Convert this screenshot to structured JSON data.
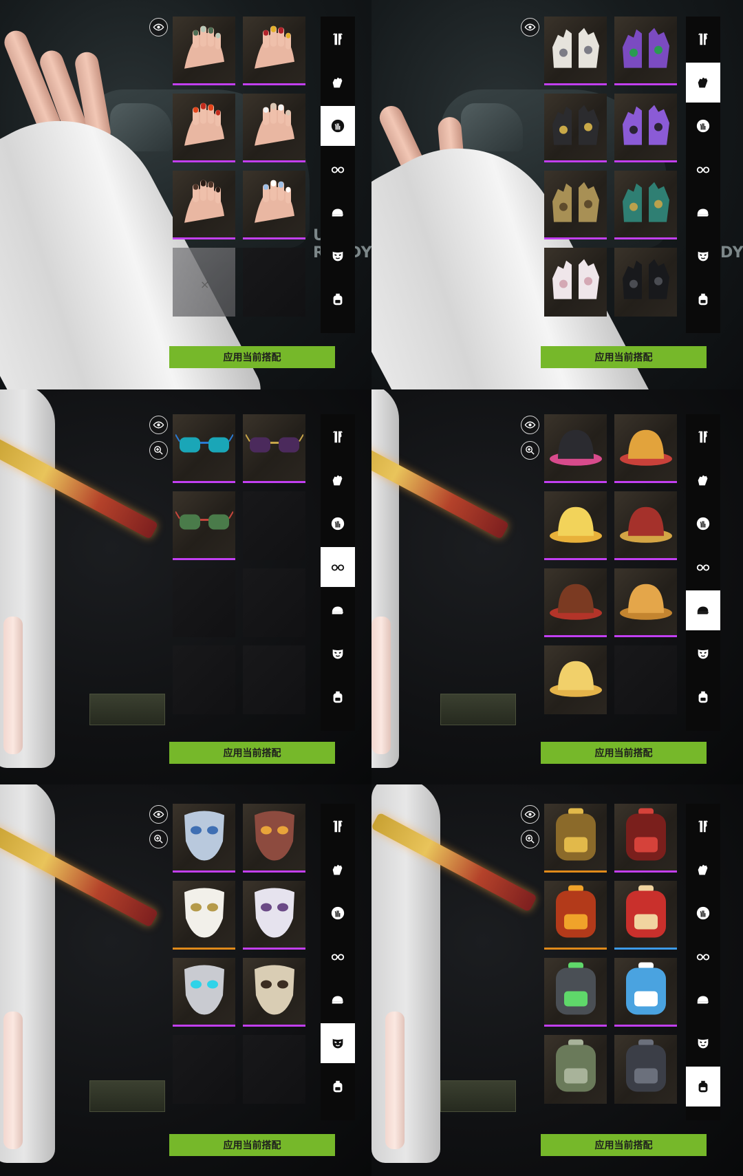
{
  "apply_label": "应用当前搭配",
  "background_text": "US READY",
  "rarity_colors": {
    "purple": "#c23ff2",
    "orange": "#e08a1a",
    "blue": "#3d9be8",
    "none": "#000000"
  },
  "accent_color": "#76b82a",
  "categories": [
    {
      "key": "outfit",
      "icon": "outfit-icon"
    },
    {
      "key": "gloves",
      "icon": "glove-icon"
    },
    {
      "key": "nails",
      "icon": "hand-nail-icon"
    },
    {
      "key": "eyewear",
      "icon": "glasses-icon"
    },
    {
      "key": "hat",
      "icon": "cap-icon"
    },
    {
      "key": "mask",
      "icon": "mask-icon"
    },
    {
      "key": "backpack",
      "icon": "backpack-icon"
    }
  ],
  "panels": [
    {
      "active_category": "nails",
      "side_buttons": [
        "eye-icon"
      ],
      "tiles": [
        {
          "item": "nail-set-green",
          "rarity": "purple"
        },
        {
          "item": "nail-set-red-gold",
          "rarity": "purple"
        },
        {
          "item": "nail-set-orange",
          "rarity": "purple"
        },
        {
          "item": "nail-set-white-gem",
          "rarity": "purple"
        },
        {
          "item": "nail-set-brown-pattern",
          "rarity": "purple"
        },
        {
          "item": "nail-set-blue-white",
          "rarity": "purple"
        },
        {
          "item": "remove-nails",
          "rarity": "none"
        },
        {
          "item": "empty",
          "rarity": "none"
        }
      ]
    },
    {
      "active_category": "gloves",
      "side_buttons": [
        "eye-icon"
      ],
      "tiles": [
        {
          "item": "glove-white-splash",
          "rarity": "purple"
        },
        {
          "item": "glove-purple-web",
          "rarity": "purple"
        },
        {
          "item": "glove-black-gold",
          "rarity": "purple"
        },
        {
          "item": "glove-purple-black",
          "rarity": "purple"
        },
        {
          "item": "glove-gold-armor",
          "rarity": "purple"
        },
        {
          "item": "glove-teal-wire",
          "rarity": "purple"
        },
        {
          "item": "glove-bunny",
          "rarity": "none"
        },
        {
          "item": "glove-black-leather",
          "rarity": "none"
        }
      ]
    },
    {
      "active_category": "eyewear",
      "side_buttons": [
        "eye-icon",
        "zoom-icon"
      ],
      "tiles": [
        {
          "item": "pixel-sunglasses",
          "rarity": "purple"
        },
        {
          "item": "round-purple-glasses",
          "rarity": "purple"
        },
        {
          "item": "star-glasses",
          "rarity": "purple"
        },
        {
          "item": "empty",
          "rarity": "none"
        },
        {
          "item": "empty",
          "rarity": "none"
        },
        {
          "item": "empty",
          "rarity": "none"
        },
        {
          "item": "empty",
          "rarity": "none"
        },
        {
          "item": "empty",
          "rarity": "none"
        }
      ]
    },
    {
      "active_category": "hat",
      "side_buttons": [
        "eye-icon",
        "zoom-icon"
      ],
      "tiles": [
        {
          "item": "cat-ear-headphones",
          "rarity": "purple"
        },
        {
          "item": "straw-hat",
          "rarity": "purple"
        },
        {
          "item": "chick-hat",
          "rarity": "purple"
        },
        {
          "item": "dragon-helm",
          "rarity": "purple"
        },
        {
          "item": "reindeer-hat",
          "rarity": "purple"
        },
        {
          "item": "bear-beanie",
          "rarity": "purple"
        },
        {
          "item": "duck-hat",
          "rarity": "none"
        },
        {
          "item": "empty",
          "rarity": "none"
        }
      ]
    },
    {
      "active_category": "mask",
      "side_buttons": [
        "eye-icon",
        "zoom-icon"
      ],
      "tiles": [
        {
          "item": "crystal-tiara-mask",
          "rarity": "purple"
        },
        {
          "item": "demon-horn-mask",
          "rarity": "purple"
        },
        {
          "item": "bunny-goggle-mask",
          "rarity": "orange"
        },
        {
          "item": "unicorn-mask",
          "rarity": "purple"
        },
        {
          "item": "cyan-visor-mask",
          "rarity": "purple"
        },
        {
          "item": "skull-feather-mask",
          "rarity": "purple"
        },
        {
          "item": "empty",
          "rarity": "none"
        },
        {
          "item": "empty",
          "rarity": "none"
        }
      ]
    },
    {
      "active_category": "backpack",
      "side_buttons": [
        "eye-icon",
        "zoom-icon"
      ],
      "tiles": [
        {
          "item": "golden-bow-pack",
          "rarity": "orange"
        },
        {
          "item": "red-round-pack",
          "rarity": "purple"
        },
        {
          "item": "fire-ring-pack",
          "rarity": "orange"
        },
        {
          "item": "lion-dance-pack",
          "rarity": "blue"
        },
        {
          "item": "drone-pack",
          "rarity": "purple"
        },
        {
          "item": "shark-pack",
          "rarity": "purple"
        },
        {
          "item": "camo-pack",
          "rarity": "none"
        },
        {
          "item": "tactical-pack",
          "rarity": "none"
        }
      ]
    }
  ]
}
